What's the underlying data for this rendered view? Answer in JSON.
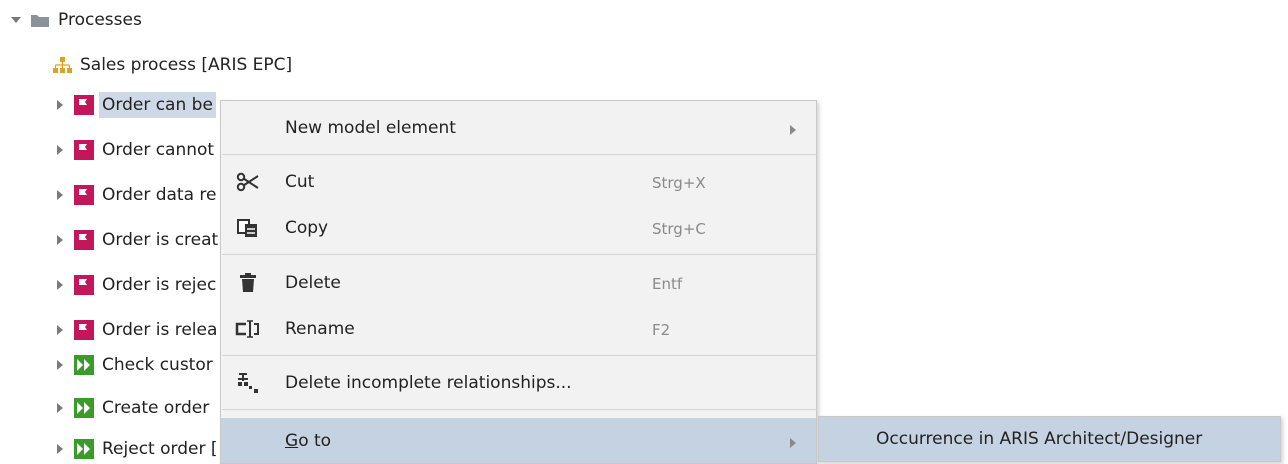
{
  "tree": {
    "root": {
      "label": "Processes",
      "icon": "folder-icon",
      "expanded": true
    },
    "items": [
      {
        "label": "Sales process [ARIS EPC]",
        "icon": "epc-model-icon"
      },
      {
        "label": "Order can be",
        "icon": "event-icon",
        "selected": true
      },
      {
        "label": "Order cannot",
        "icon": "event-icon"
      },
      {
        "label": "Order data re",
        "icon": "event-icon"
      },
      {
        "label": "Order is creat",
        "icon": "event-icon"
      },
      {
        "label": "Order is rejec",
        "icon": "event-icon"
      },
      {
        "label": "Order is relea",
        "icon": "event-icon"
      },
      {
        "label": "Check custor",
        "icon": "function-icon"
      },
      {
        "label": "Create order",
        "icon": "function-icon"
      },
      {
        "label": "Reject order [",
        "icon": "function-icon"
      }
    ]
  },
  "context_menu": {
    "new_model_element": {
      "label": "New model element"
    },
    "cut": {
      "label": "Cut",
      "shortcut": "Strg+X"
    },
    "copy": {
      "label": "Copy",
      "shortcut": "Strg+C"
    },
    "delete": {
      "label": "Delete",
      "shortcut": "Entf"
    },
    "rename": {
      "label": "Rename",
      "shortcut": "F2"
    },
    "delete_incomplete": {
      "label": "Delete incomplete relationships..."
    },
    "go_to": {
      "label_first": "G",
      "label_rest": "o to"
    }
  },
  "submenu": {
    "occurrence": {
      "label": "Occurrence in ARIS Architect/Designer"
    }
  },
  "colors": {
    "event": "#c2185b",
    "function": "#3a9a2a",
    "selection": "#cfd8e6",
    "menu_highlight": "#c5d2e2",
    "menu_bg": "#f2f2f2"
  }
}
